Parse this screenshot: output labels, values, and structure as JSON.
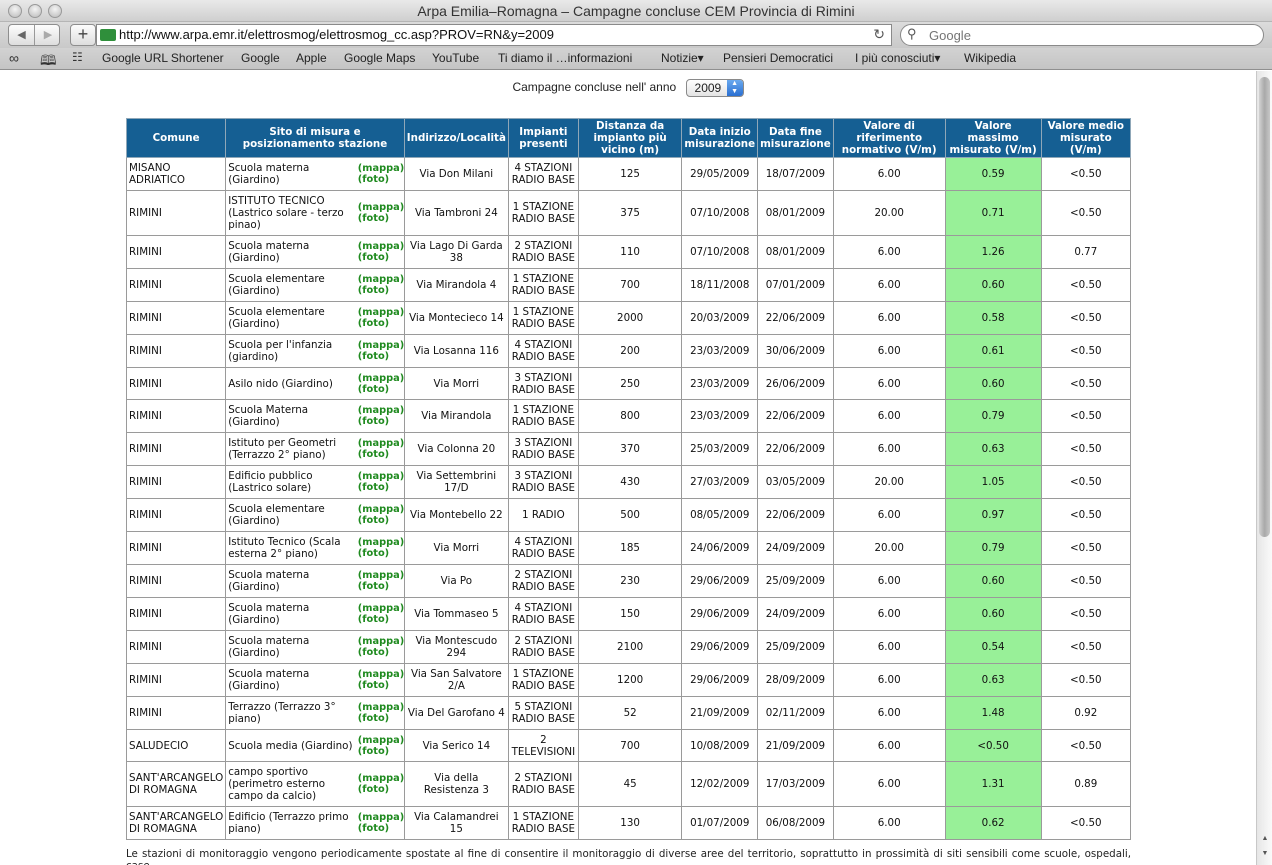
{
  "window": {
    "title": "Arpa Emilia–Romagna – Campagne concluse CEM Provincia di Rimini"
  },
  "toolbar": {
    "url": "http://www.arpa.emr.it/elettrosmog/elettrosmog_cc.asp?PROV=RN&y=2009",
    "search_placeholder": "Google",
    "add_label": "+",
    "back_label": "◀",
    "forward_label": "▶",
    "reload_label": "↻"
  },
  "bookmarks": [
    {
      "label": "Google URL Shortener"
    },
    {
      "label": "Google"
    },
    {
      "label": "Apple"
    },
    {
      "label": "Google Maps"
    },
    {
      "label": "YouTube"
    },
    {
      "label": "Ti diamo il …informazioni"
    },
    {
      "label": "Notizie▾"
    },
    {
      "label": "Pensieri Democratici"
    },
    {
      "label": "I più conosciuti▾"
    },
    {
      "label": "Wikipedia"
    }
  ],
  "page": {
    "year_label": "Campagne concluse nell' anno",
    "year_value": "2009",
    "link_map": "(mappa)",
    "link_photo": "(foto)",
    "columns": [
      "Comune",
      "Sito di misura e posizionamento stazione",
      "Indirizzo/Località",
      "Impianti presenti",
      "Distanza da impianto più vicino (m)",
      "Data inizio misurazione",
      "Data fine misurazione",
      "Valore di riferimento normativo (V/m)",
      "Valore massimo misurato (V/m)",
      "Valore medio misurato (V/m)"
    ],
    "rows": [
      {
        "comune": "MISANO ADRIATICO",
        "sito": "Scuola materna (Giardino)",
        "indirizzo": "Via Don Milani",
        "impianti": "4 STAZIONI RADIO BASE",
        "distanza": "125",
        "inizio": "29/05/2009",
        "fine": "18/07/2009",
        "riferimento": "6.00",
        "massimo": "0.59",
        "medio": "<0.50"
      },
      {
        "comune": "RIMINI",
        "sito": "ISTITUTO TECNICO (Lastrico solare - terzo pinao)",
        "indirizzo": "Via Tambroni 24",
        "impianti": "1 STAZIONE RADIO BASE",
        "distanza": "375",
        "inizio": "07/10/2008",
        "fine": "08/01/2009",
        "riferimento": "20.00",
        "massimo": "0.71",
        "medio": "<0.50"
      },
      {
        "comune": "RIMINI",
        "sito": "Scuola materna (Giardino)",
        "indirizzo": "Via Lago Di Garda 38",
        "impianti": "2 STAZIONI RADIO BASE",
        "distanza": "110",
        "inizio": "07/10/2008",
        "fine": "08/01/2009",
        "riferimento": "6.00",
        "massimo": "1.26",
        "medio": "0.77"
      },
      {
        "comune": "RIMINI",
        "sito": "Scuola elementare (Giardino)",
        "indirizzo": "Via Mirandola 4",
        "impianti": "1 STAZIONE RADIO BASE",
        "distanza": "700",
        "inizio": "18/11/2008",
        "fine": "07/01/2009",
        "riferimento": "6.00",
        "massimo": "0.60",
        "medio": "<0.50"
      },
      {
        "comune": "RIMINI",
        "sito": "Scuola elementare (Giardino)",
        "indirizzo": "Via Montecieco 14",
        "impianti": "1 STAZIONE RADIO BASE",
        "distanza": "2000",
        "inizio": "20/03/2009",
        "fine": "22/06/2009",
        "riferimento": "6.00",
        "massimo": "0.58",
        "medio": "<0.50"
      },
      {
        "comune": "RIMINI",
        "sito": "Scuola per l'infanzia (giardino)",
        "indirizzo": "Via Losanna 116",
        "impianti": "4 STAZIONI RADIO BASE",
        "distanza": "200",
        "inizio": "23/03/2009",
        "fine": "30/06/2009",
        "riferimento": "6.00",
        "massimo": "0.61",
        "medio": "<0.50"
      },
      {
        "comune": "RIMINI",
        "sito": "Asilo nido (Giardino)",
        "indirizzo": "Via Morri",
        "impianti": "3 STAZIONI RADIO BASE",
        "distanza": "250",
        "inizio": "23/03/2009",
        "fine": "26/06/2009",
        "riferimento": "6.00",
        "massimo": "0.60",
        "medio": "<0.50"
      },
      {
        "comune": "RIMINI",
        "sito": "Scuola Materna (Giardino)",
        "indirizzo": "Via Mirandola",
        "impianti": "1 STAZIONE RADIO BASE",
        "distanza": "800",
        "inizio": "23/03/2009",
        "fine": "22/06/2009",
        "riferimento": "6.00",
        "massimo": "0.79",
        "medio": "<0.50"
      },
      {
        "comune": "RIMINI",
        "sito": "Istituto per Geometri (Terrazzo 2° piano)",
        "indirizzo": "Via Colonna 20",
        "impianti": "3 STAZIONI RADIO BASE",
        "distanza": "370",
        "inizio": "25/03/2009",
        "fine": "22/06/2009",
        "riferimento": "6.00",
        "massimo": "0.63",
        "medio": "<0.50"
      },
      {
        "comune": "RIMINI",
        "sito": "Edificio pubblico (Lastrico solare)",
        "indirizzo": "Via Settembrini 17/D",
        "impianti": "3 STAZIONI RADIO BASE",
        "distanza": "430",
        "inizio": "27/03/2009",
        "fine": "03/05/2009",
        "riferimento": "20.00",
        "massimo": "1.05",
        "medio": "<0.50"
      },
      {
        "comune": "RIMINI",
        "sito": "Scuola elementare (Giardino)",
        "indirizzo": "Via Montebello 22",
        "impianti": "1 RADIO",
        "distanza": "500",
        "inizio": "08/05/2009",
        "fine": "22/06/2009",
        "riferimento": "6.00",
        "massimo": "0.97",
        "medio": "<0.50"
      },
      {
        "comune": "RIMINI",
        "sito": "Istituto Tecnico (Scala esterna 2° piano)",
        "indirizzo": "Via Morri",
        "impianti": "4 STAZIONI RADIO BASE",
        "distanza": "185",
        "inizio": "24/06/2009",
        "fine": "24/09/2009",
        "riferimento": "20.00",
        "massimo": "0.79",
        "medio": "<0.50"
      },
      {
        "comune": "RIMINI",
        "sito": "Scuola materna (Giardino)",
        "indirizzo": "Via Po",
        "impianti": "2 STAZIONI RADIO BASE",
        "distanza": "230",
        "inizio": "29/06/2009",
        "fine": "25/09/2009",
        "riferimento": "6.00",
        "massimo": "0.60",
        "medio": "<0.50"
      },
      {
        "comune": "RIMINI",
        "sito": "Scuola materna (Giardino)",
        "indirizzo": "Via Tommaseo 5",
        "impianti": "4 STAZIONI RADIO BASE",
        "distanza": "150",
        "inizio": "29/06/2009",
        "fine": "24/09/2009",
        "riferimento": "6.00",
        "massimo": "0.60",
        "medio": "<0.50"
      },
      {
        "comune": "RIMINI",
        "sito": "Scuola materna (Giardino)",
        "indirizzo": "Via Montescudo 294",
        "impianti": "2 STAZIONI RADIO BASE",
        "distanza": "2100",
        "inizio": "29/06/2009",
        "fine": "25/09/2009",
        "riferimento": "6.00",
        "massimo": "0.54",
        "medio": "<0.50"
      },
      {
        "comune": "RIMINI",
        "sito": "Scuola materna (Giardino)",
        "indirizzo": "Via San Salvatore 2/A",
        "impianti": "1 STAZIONE RADIO BASE",
        "distanza": "1200",
        "inizio": "29/06/2009",
        "fine": "28/09/2009",
        "riferimento": "6.00",
        "massimo": "0.63",
        "medio": "<0.50"
      },
      {
        "comune": "RIMINI",
        "sito": "Terrazzo (Terrazzo 3° piano)",
        "indirizzo": "Via Del Garofano 4",
        "impianti": "5 STAZIONI RADIO BASE",
        "distanza": "52",
        "inizio": "21/09/2009",
        "fine": "02/11/2009",
        "riferimento": "6.00",
        "massimo": "1.48",
        "medio": "0.92"
      },
      {
        "comune": "SALUDECIO",
        "sito": "Scuola media (Giardino)",
        "indirizzo": "Via Serico 14",
        "impianti": "2 TELEVISIONI",
        "distanza": "700",
        "inizio": "10/08/2009",
        "fine": "21/09/2009",
        "riferimento": "6.00",
        "massimo": "<0.50",
        "medio": "<0.50"
      },
      {
        "comune": "SANT'ARCANGELO DI ROMAGNA",
        "sito": "campo sportivo (perimetro esterno campo da calcio)",
        "indirizzo": "Via della Resistenza 3",
        "impianti": "2 STAZIONI RADIO BASE",
        "distanza": "45",
        "inizio": "12/02/2009",
        "fine": "17/03/2009",
        "riferimento": "6.00",
        "massimo": "1.31",
        "medio": "0.89"
      },
      {
        "comune": "SANT'ARCANGELO DI ROMAGNA",
        "sito": "Edificio (Terrazzo primo piano)",
        "indirizzo": "Via Calamandrei 15",
        "impianti": "1 STAZIONE RADIO BASE",
        "distanza": "130",
        "inizio": "01/07/2009",
        "fine": "06/08/2009",
        "riferimento": "6.00",
        "massimo": "0.62",
        "medio": "<0.50"
      }
    ],
    "footer": "Le stazioni di monitoraggio vengono periodicamente spostate al fine di consentire il monitoraggio di diverse aree del territorio, soprattutto in prossimità di siti sensibili come scuole, ospedali, case"
  },
  "colors": {
    "header_bg": "#155f93",
    "max_cell_bg": "#98f098",
    "link_green": "#1f8a1f"
  }
}
